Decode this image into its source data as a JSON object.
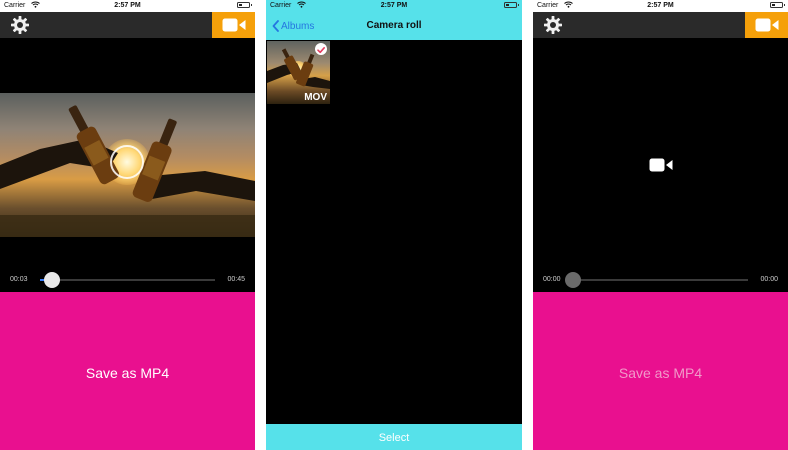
{
  "colors": {
    "accent_orange": "#f5a00a",
    "save_pink": "#e9108f",
    "picker_cyan": "#56e1ea",
    "link_blue": "#2576e0",
    "slider_blue": "#3478f6"
  },
  "status_bar": {
    "carrier": "Carrier",
    "time": "2:57 PM"
  },
  "left_screen": {
    "settings_icon": "gear-icon",
    "record_icon": "video-camera-icon",
    "playback": {
      "current_time": "00:03",
      "duration": "00:45",
      "progress": 0.07
    },
    "save_label": "Save as MP4"
  },
  "middle_screen": {
    "back_label": "Albums",
    "title": "Camera roll",
    "thumbnail": {
      "badge": "MOV",
      "selected": true
    },
    "select_label": "Select"
  },
  "right_screen": {
    "settings_icon": "gear-icon",
    "record_icon": "video-camera-icon",
    "placeholder_icon": "video-camera-icon",
    "playback": {
      "current_time": "00:00",
      "duration": "00:00",
      "progress": 0
    },
    "save_label": "Save as MP4"
  }
}
